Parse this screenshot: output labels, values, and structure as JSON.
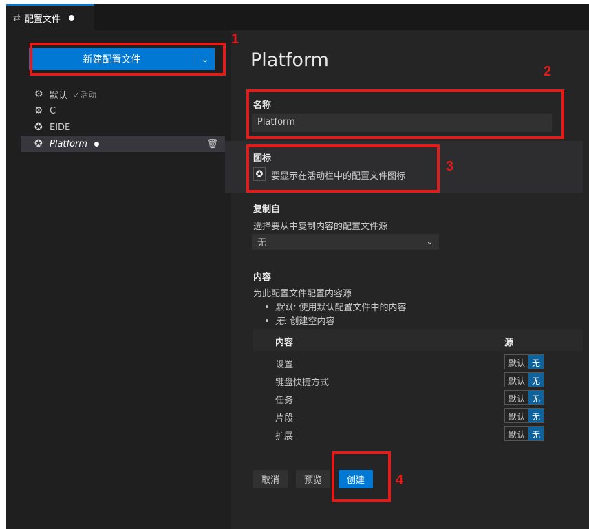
{
  "tab": {
    "icon": "settings-sliders-icon",
    "label": "配置文件"
  },
  "new_profile_button": {
    "label": "新建配置文件"
  },
  "profiles": [
    {
      "icon": "gear-icon",
      "name": "默认",
      "status": "✓活动"
    },
    {
      "icon": "gear-icon",
      "name": "C"
    },
    {
      "icon": "chip-icon",
      "name": "EIDE"
    },
    {
      "icon": "chip-icon",
      "name": "Platform",
      "selected": true
    }
  ],
  "editor": {
    "title": "Platform",
    "name_section": {
      "label": "名称",
      "value": "Platform"
    },
    "icon_section": {
      "label": "图标",
      "description": "要显示在活动栏中的配置文件图标"
    },
    "copy_from": {
      "label": "复制自",
      "description": "选择要从中复制内容的配置文件源",
      "selected": "无"
    },
    "contents": {
      "label": "内容",
      "description": "为此配置文件配置内容源",
      "bullets": [
        {
          "term": "默认:",
          "text": " 使用默认配置文件中的内容"
        },
        {
          "term": "无:",
          "text": " 创建空内容"
        }
      ],
      "table": {
        "col_content": "内容",
        "col_source": "源",
        "option_default": "默认",
        "option_none": "无",
        "rows": [
          "设置",
          "键盘快捷方式",
          "任务",
          "片段",
          "扩展"
        ]
      }
    },
    "buttons": {
      "cancel": "取消",
      "preview": "预览",
      "create": "创建"
    }
  },
  "annotations": [
    "1",
    "2",
    "3",
    "4"
  ],
  "colors": {
    "accent": "#0078d4",
    "annotation": "#e21b1b"
  }
}
